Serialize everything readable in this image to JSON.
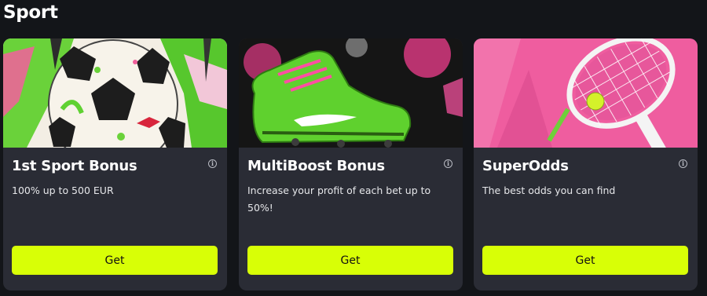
{
  "section": {
    "title": "Sport"
  },
  "cards": [
    {
      "title": "1st Sport Bonus",
      "description": "100% up to 500 EUR",
      "button_label": "Get",
      "info_glyph": "i",
      "image": "soccer-ball-paint-splash"
    },
    {
      "title": "MultiBoost Bonus",
      "description": "Increase your profit of each bet up to 50%!",
      "button_label": "Get",
      "info_glyph": "i",
      "image": "green-football-boot"
    },
    {
      "title": "SuperOdds",
      "description": "The best odds you can find",
      "button_label": "Get",
      "info_glyph": "i",
      "image": "tennis-racket-and-ball"
    }
  ],
  "colors": {
    "background": "#131519",
    "card": "#2a2c35",
    "accent_button": "#d8ff06",
    "neon_green": "#56d12a",
    "neon_pink": "#f0609e"
  }
}
